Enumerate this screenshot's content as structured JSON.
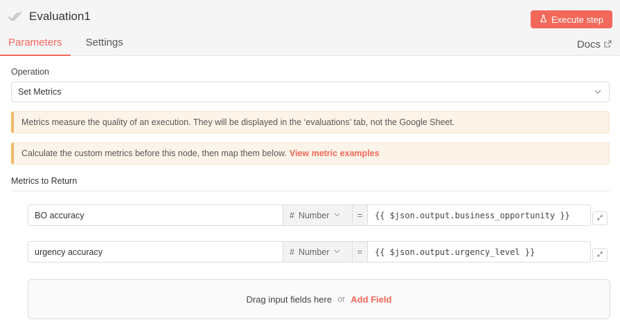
{
  "header": {
    "title": "Evaluation1",
    "execute_label": "Execute step",
    "docs_label": "Docs",
    "tabs": [
      {
        "label": "Parameters",
        "active": true
      },
      {
        "label": "Settings",
        "active": false
      }
    ]
  },
  "operation": {
    "label": "Operation",
    "value": "Set Metrics"
  },
  "notices": {
    "info": "Metrics measure the quality of an execution. They will be displayed in the ‘evaluations’ tab, not the Google Sheet.",
    "calc": "Calculate the custom metrics before this node, then map them below.",
    "calc_link": "View metric examples"
  },
  "metrics": {
    "label": "Metrics to Return",
    "fields": [
      {
        "name": "BO accuracy",
        "type": "Number",
        "eq": "=",
        "expression": "{{ $json.output.business_opportunity }}"
      },
      {
        "name": "urgency accuracy",
        "type": "Number",
        "eq": "=",
        "expression": "{{ $json.output.urgency_level }}"
      }
    ]
  },
  "dropzone": {
    "text": "Drag input fields here",
    "or": "or",
    "add_label": "Add Field"
  },
  "colors": {
    "accent": "#f2685a",
    "notice_bg": "#fdf4e9",
    "notice_border": "#f1b968"
  }
}
